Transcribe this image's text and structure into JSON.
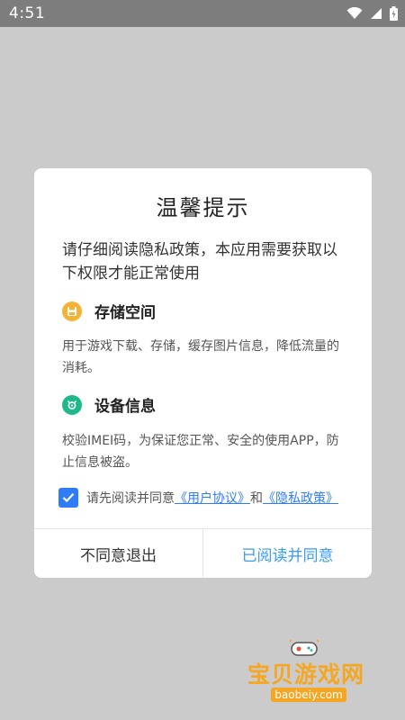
{
  "status_bar": {
    "time": "4:51",
    "icons": [
      "wifi-icon",
      "signal-icon",
      "battery-icon"
    ]
  },
  "dialog": {
    "title": "温馨提示",
    "intro": "请仔细阅读隐私政策，本应用需要获取以下权限才能正常使用",
    "permissions": [
      {
        "icon": "storage-icon",
        "title": "存储空间",
        "description": "用于游戏下载、存储，缓存图片信息，降低流量的消耗。"
      },
      {
        "icon": "device-info-icon",
        "title": "设备信息",
        "description": "校验IMEI码，为保证您正常、安全的使用APP，防止信息被盗。"
      }
    ],
    "agreement": {
      "checked": true,
      "prefix": "请先阅读并同意",
      "user_agreement": "《用户协议》",
      "conjunction": "和",
      "privacy_policy": "《隐私政策》"
    },
    "buttons": {
      "reject": "不同意退出",
      "accept": "已阅读并同意"
    }
  },
  "watermark": {
    "text": "宝贝游戏网",
    "url": "baobeiy.com"
  },
  "colors": {
    "accent": "#2f7df6",
    "accept_text": "#3a9bf5",
    "storage_icon": "#f5b335",
    "device_icon": "#1fb88a",
    "watermark": "#f5a623"
  }
}
